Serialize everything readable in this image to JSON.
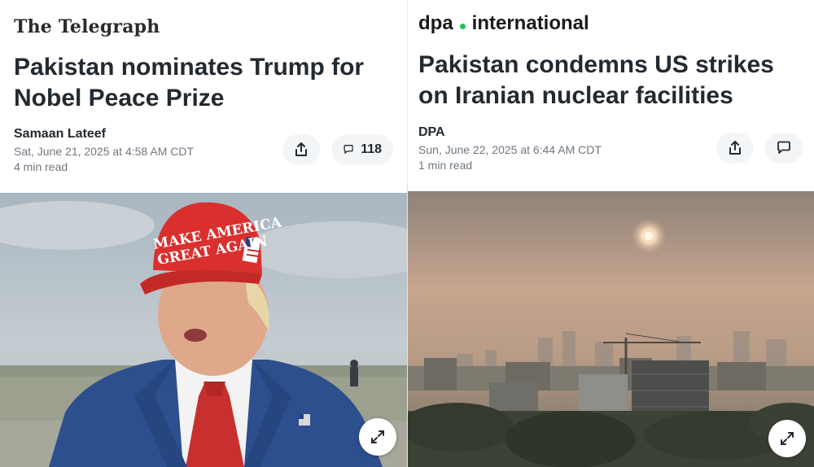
{
  "colors": {
    "dpa_dot": "#1fc25b",
    "headline": "#232a31",
    "meta": "#6e7780",
    "button_bg": "#f4f5f6"
  },
  "left_article": {
    "source_logo": "The Telegraph",
    "headline": "Pakistan nominates Trump for Nobel Peace Prize",
    "author": "Samaan Lateef",
    "date": "Sat, June 21, 2025 at 4:58 AM CDT",
    "read_time": "4 min read",
    "comment_count": "118",
    "share_icon": "share-icon",
    "comment_icon": "comment-icon",
    "expand_icon": "expand-icon",
    "photo_hat_line1": "MAKE AMERICA",
    "photo_hat_line2": "GREAT AGAIN"
  },
  "right_article": {
    "source_logo_left": "dpa",
    "source_logo_right": "international",
    "headline": "Pakistan condemns US strikes on Iranian nuclear facilities",
    "author": "DPA",
    "date": "Sun, June 22, 2025 at 6:44 AM CDT",
    "read_time": "1 min read",
    "share_icon": "share-icon",
    "comment_icon": "comment-icon",
    "expand_icon": "expand-icon"
  }
}
